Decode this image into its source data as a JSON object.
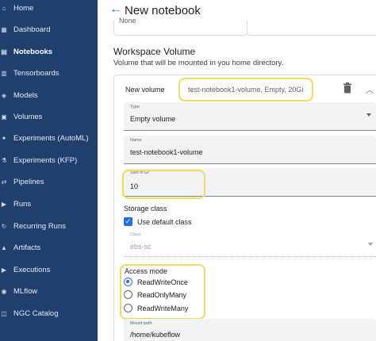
{
  "sidebar": {
    "items": [
      {
        "label": "Home",
        "icon": "home-icon",
        "glyph": "⌂"
      },
      {
        "label": "Dashboard",
        "icon": "dashboard-icon",
        "glyph": "▦"
      },
      {
        "label": "Notebooks",
        "icon": "notebook-icon",
        "glyph": "▤",
        "active": true
      },
      {
        "label": "Tensorboards",
        "icon": "tensorboard-icon",
        "glyph": "▥"
      },
      {
        "label": "Models",
        "icon": "models-icon",
        "glyph": "◈"
      },
      {
        "label": "Volumes",
        "icon": "volumes-icon",
        "glyph": "▣"
      },
      {
        "label": "Experiments (AutoML)",
        "icon": "automl-icon",
        "glyph": "✦"
      },
      {
        "label": "Experiments (KFP)",
        "icon": "kfp-icon",
        "glyph": "⚗"
      },
      {
        "label": "Pipelines",
        "icon": "pipelines-icon",
        "glyph": "⇄"
      },
      {
        "label": "Runs",
        "icon": "runs-icon",
        "glyph": "▶"
      },
      {
        "label": "Recurring Runs",
        "icon": "recurring-runs-icon",
        "glyph": "↻"
      },
      {
        "label": "Artifacts",
        "icon": "artifacts-icon",
        "glyph": "▲"
      },
      {
        "label": "Executions",
        "icon": "executions-icon",
        "glyph": "▶"
      },
      {
        "label": "MLflow",
        "icon": "mlflow-icon",
        "glyph": "◉"
      },
      {
        "label": "NGC Catalog",
        "icon": "ngc-catalog-icon",
        "glyph": "◫"
      }
    ]
  },
  "header": {
    "back_icon": "arrow-back-icon",
    "title": "New notebook"
  },
  "previous_field": {
    "value": "None"
  },
  "workspace_volume": {
    "title": "Workspace Volume",
    "subtitle": "Volume that will be mounted in you home directory.",
    "new_volume_label": "New volume",
    "summary": "test-notebook1-volume, Empty, 20Gi",
    "type": {
      "label": "Type",
      "value": "Empty volume"
    },
    "name": {
      "label": "Name",
      "value": "test-notebook1-volume"
    },
    "size": {
      "label": "Size in Gi",
      "value": "10"
    },
    "storage_class": {
      "label": "Storage class",
      "use_default_label": "Use default class",
      "use_default_checked": true,
      "class_label": "Class",
      "class_value": "ebs-sc"
    },
    "access_mode": {
      "label": "Access mode",
      "options": [
        "ReadWriteOnce",
        "ReadOnlyMany",
        "ReadWriteMany"
      ],
      "selected": "ReadWriteOnce"
    },
    "mount_path": {
      "label": "Mount path",
      "value": "/home/kubeflow"
    }
  },
  "colors": {
    "sidebar_bg": "#1f3f6f",
    "accent": "#1a73e8",
    "highlight": "#f0dc5a"
  }
}
